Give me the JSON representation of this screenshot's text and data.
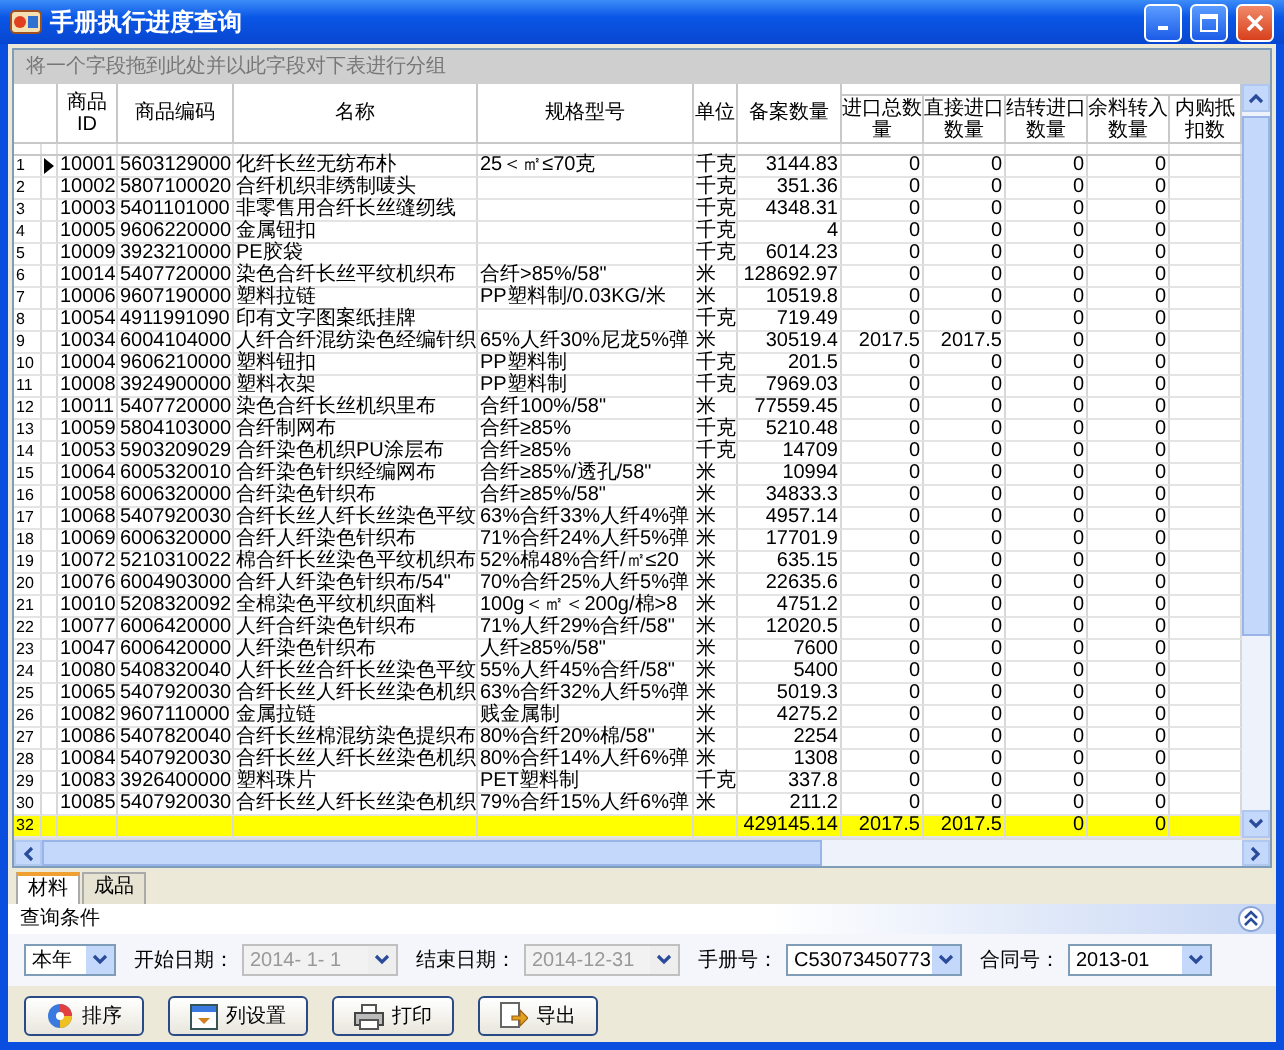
{
  "window": {
    "title": "手册执行进度查询"
  },
  "group_panel": {
    "hint": "将一个字段拖到此处并以此字段对下表进行分组"
  },
  "table": {
    "columns": [
      {
        "label": "商品ID",
        "banded": false
      },
      {
        "label": "商品编码",
        "banded": false
      },
      {
        "label": "名称",
        "banded": false
      },
      {
        "label": "规格型号",
        "banded": false
      },
      {
        "label": "单位",
        "banded": false
      },
      {
        "label": "备案数量",
        "banded": false
      },
      {
        "label": "进口总数量",
        "banded": true
      },
      {
        "label": "直接进口数量",
        "banded": true
      },
      {
        "label": "结转进口数量",
        "banded": true
      },
      {
        "label": "余料转入数量",
        "banded": true
      },
      {
        "label": "内购抵扣数",
        "banded": true
      }
    ],
    "rows": [
      {
        "number": "1",
        "current": true,
        "cells": [
          "10001",
          "5603129000",
          "化纤长丝无纺布朴",
          "25＜㎡≤70克",
          "千克",
          "3144.83",
          "0",
          "0",
          "0",
          "0",
          ""
        ]
      },
      {
        "number": "2",
        "current": false,
        "cells": [
          "10002",
          "5807100020",
          "合纤机织非绣制唛头",
          "",
          "千克",
          "351.36",
          "0",
          "0",
          "0",
          "0",
          ""
        ]
      },
      {
        "number": "3",
        "current": false,
        "cells": [
          "10003",
          "5401101000",
          "非零售用合纤长丝缝纫线",
          "",
          "千克",
          "4348.31",
          "0",
          "0",
          "0",
          "0",
          ""
        ]
      },
      {
        "number": "4",
        "current": false,
        "cells": [
          "10005",
          "9606220000",
          "金属钮扣",
          "",
          "千克",
          "4",
          "0",
          "0",
          "0",
          "0",
          ""
        ]
      },
      {
        "number": "5",
        "current": false,
        "cells": [
          "10009",
          "3923210000",
          "PE胶袋",
          "",
          "千克",
          "6014.23",
          "0",
          "0",
          "0",
          "0",
          ""
        ]
      },
      {
        "number": "6",
        "current": false,
        "cells": [
          "10014",
          "5407720000",
          "染色合纤长丝平纹机织布",
          "合纤>85%/58\"",
          "米",
          "128692.97",
          "0",
          "0",
          "0",
          "0",
          ""
        ]
      },
      {
        "number": "7",
        "current": false,
        "cells": [
          "10006",
          "9607190000",
          "塑料拉链",
          "PP塑料制/0.03KG/米",
          "米",
          "10519.8",
          "0",
          "0",
          "0",
          "0",
          ""
        ]
      },
      {
        "number": "8",
        "current": false,
        "cells": [
          "10054",
          "4911991090",
          "印有文字图案纸挂牌",
          "",
          "千克",
          "719.49",
          "0",
          "0",
          "0",
          "0",
          ""
        ]
      },
      {
        "number": "9",
        "current": false,
        "cells": [
          "10034",
          "6004104000",
          "人纤合纤混纺染色经编针织",
          "65%人纤30%尼龙5%弹",
          "米",
          "30519.4",
          "2017.5",
          "2017.5",
          "0",
          "0",
          ""
        ]
      },
      {
        "number": "10",
        "current": false,
        "cells": [
          "10004",
          "9606210000",
          "塑料钮扣",
          "PP塑料制",
          "千克",
          "201.5",
          "0",
          "0",
          "0",
          "0",
          ""
        ]
      },
      {
        "number": "11",
        "current": false,
        "cells": [
          "10008",
          "3924900000",
          "塑料衣架",
          "PP塑料制",
          "千克",
          "7969.03",
          "0",
          "0",
          "0",
          "0",
          ""
        ]
      },
      {
        "number": "12",
        "current": false,
        "cells": [
          "10011",
          "5407720000",
          "染色合纤长丝机织里布",
          "合纤100%/58\"",
          "米",
          "77559.45",
          "0",
          "0",
          "0",
          "0",
          ""
        ]
      },
      {
        "number": "13",
        "current": false,
        "cells": [
          "10059",
          "5804103000",
          "合纤制网布",
          "合纤≥85%",
          "千克",
          "5210.48",
          "0",
          "0",
          "0",
          "0",
          ""
        ]
      },
      {
        "number": "14",
        "current": false,
        "cells": [
          "10053",
          "5903209029",
          "合纤染色机织PU涂层布",
          "合纤≥85%",
          "千克",
          "14709",
          "0",
          "0",
          "0",
          "0",
          ""
        ]
      },
      {
        "number": "15",
        "current": false,
        "cells": [
          "10064",
          "6005320010",
          "合纤染色针织经编网布",
          "合纤≥85%/透孔/58\"",
          "米",
          "10994",
          "0",
          "0",
          "0",
          "0",
          ""
        ]
      },
      {
        "number": "16",
        "current": false,
        "cells": [
          "10058",
          "6006320000",
          "合纤染色针织布",
          "合纤≥85%/58\"",
          "米",
          "34833.3",
          "0",
          "0",
          "0",
          "0",
          ""
        ]
      },
      {
        "number": "17",
        "current": false,
        "cells": [
          "10068",
          "5407920030",
          "合纤长丝人纤长丝染色平纹",
          "63%合纤33%人纤4%弹",
          "米",
          "4957.14",
          "0",
          "0",
          "0",
          "0",
          ""
        ]
      },
      {
        "number": "18",
        "current": false,
        "cells": [
          "10069",
          "6006320000",
          "合纤人纤染色针织布",
          "71%合纤24%人纤5%弹",
          "米",
          "17701.9",
          "0",
          "0",
          "0",
          "0",
          ""
        ]
      },
      {
        "number": "19",
        "current": false,
        "cells": [
          "10072",
          "5210310022",
          "棉合纤长丝染色平纹机织布",
          "52%棉48%合纤/㎡≤20",
          "米",
          "635.15",
          "0",
          "0",
          "0",
          "0",
          ""
        ]
      },
      {
        "number": "20",
        "current": false,
        "cells": [
          "10076",
          "6004903000",
          "合纤人纤染色针织布/54\"",
          "70%合纤25%人纤5%弹",
          "米",
          "22635.6",
          "0",
          "0",
          "0",
          "0",
          ""
        ]
      },
      {
        "number": "21",
        "current": false,
        "cells": [
          "10010",
          "5208320092",
          "全棉染色平纹机织面料",
          "100g＜㎡＜200g/棉>8",
          "米",
          "4751.2",
          "0",
          "0",
          "0",
          "0",
          ""
        ]
      },
      {
        "number": "22",
        "current": false,
        "cells": [
          "10077",
          "6006420000",
          "人纤合纤染色针织布",
          "71%人纤29%合纤/58\"",
          "米",
          "12020.5",
          "0",
          "0",
          "0",
          "0",
          ""
        ]
      },
      {
        "number": "23",
        "current": false,
        "cells": [
          "10047",
          "6006420000",
          "人纤染色针织布",
          "人纤≥85%/58\"",
          "米",
          "7600",
          "0",
          "0",
          "0",
          "0",
          ""
        ]
      },
      {
        "number": "24",
        "current": false,
        "cells": [
          "10080",
          "5408320040",
          "人纤长丝合纤长丝染色平纹",
          "55%人纤45%合纤/58\"",
          "米",
          "5400",
          "0",
          "0",
          "0",
          "0",
          ""
        ]
      },
      {
        "number": "25",
        "current": false,
        "cells": [
          "10065",
          "5407920030",
          "合纤长丝人纤长丝染色机织",
          "63%合纤32%人纤5%弹",
          "米",
          "5019.3",
          "0",
          "0",
          "0",
          "0",
          ""
        ]
      },
      {
        "number": "26",
        "current": false,
        "cells": [
          "10082",
          "9607110000",
          "金属拉链",
          "贱金属制",
          "米",
          "4275.2",
          "0",
          "0",
          "0",
          "0",
          ""
        ]
      },
      {
        "number": "27",
        "current": false,
        "cells": [
          "10086",
          "5407820040",
          "合纤长丝棉混纺染色提织布",
          "80%合纤20%棉/58\"",
          "米",
          "2254",
          "0",
          "0",
          "0",
          "0",
          ""
        ]
      },
      {
        "number": "28",
        "current": false,
        "cells": [
          "10084",
          "5407920030",
          "合纤长丝人纤长丝染色机织",
          "80%合纤14%人纤6%弹",
          "米",
          "1308",
          "0",
          "0",
          "0",
          "0",
          ""
        ]
      },
      {
        "number": "29",
        "current": false,
        "cells": [
          "10083",
          "3926400000",
          "塑料珠片",
          "PET塑料制",
          "千克",
          "337.8",
          "0",
          "0",
          "0",
          "0",
          ""
        ]
      },
      {
        "number": "30",
        "current": false,
        "cells": [
          "10085",
          "5407920030",
          "合纤长丝人纤长丝染色机织",
          "79%合纤15%人纤6%弹",
          "米",
          "211.2",
          "0",
          "0",
          "0",
          "0",
          ""
        ]
      }
    ],
    "totals": {
      "number": "32",
      "cells": [
        "",
        "",
        "",
        "",
        "",
        "429145.14",
        "2017.5",
        "2017.5",
        "0",
        "0",
        ""
      ]
    }
  },
  "tabs": [
    {
      "label": "材料",
      "selected": true
    },
    {
      "label": "成品",
      "selected": false
    }
  ],
  "query": {
    "title": "查询条件",
    "filters": [
      {
        "value": "本年",
        "disabled": false
      },
      {
        "label": "开始日期：",
        "value": "2014- 1- 1",
        "disabled": true
      },
      {
        "label": "结束日期：",
        "value": "2014-12-31",
        "disabled": true
      },
      {
        "label": "手册号：",
        "value": "C53073450773",
        "disabled": false
      },
      {
        "label": "合同号：",
        "value": "2013-01",
        "disabled": false
      }
    ]
  },
  "buttons": [
    {
      "label": "排序",
      "kind": "sort"
    },
    {
      "label": "列设置",
      "kind": "columns"
    },
    {
      "label": "打印",
      "kind": "print"
    },
    {
      "label": "导出",
      "kind": "export"
    }
  ]
}
